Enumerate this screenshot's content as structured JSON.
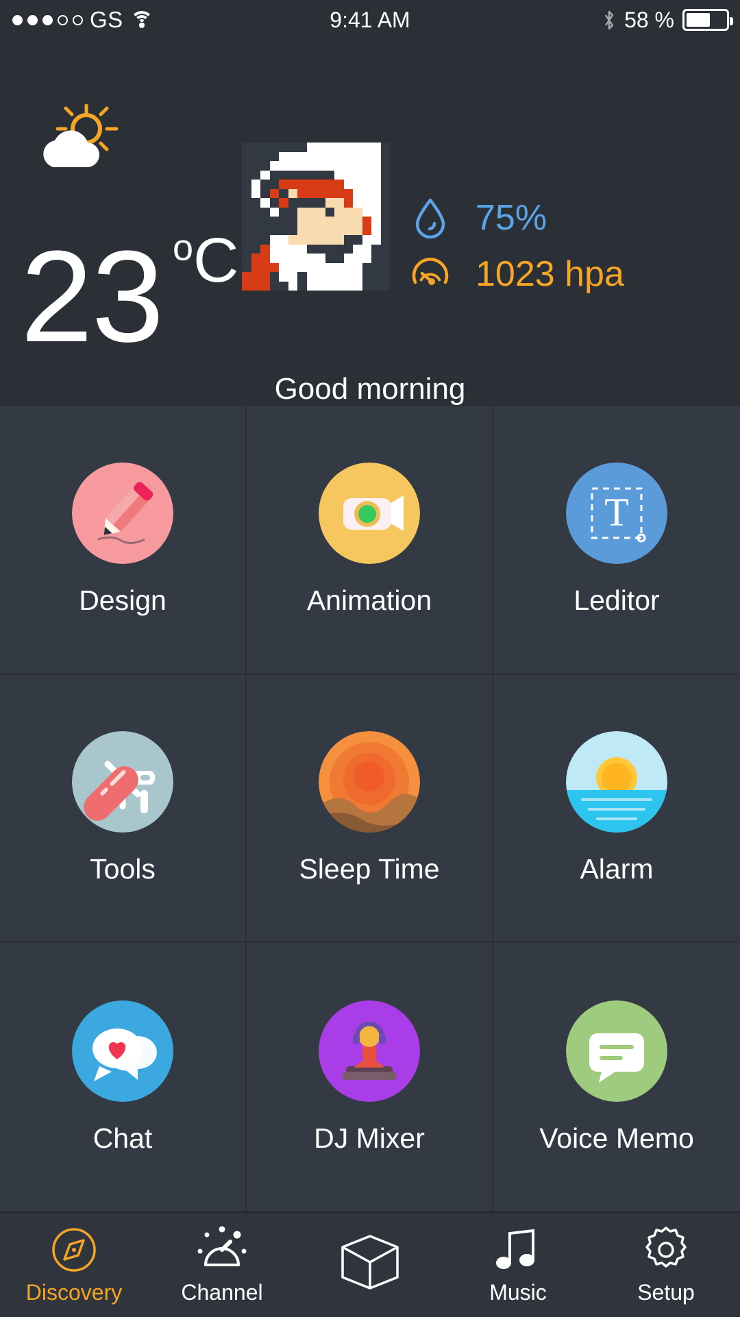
{
  "statusbar": {
    "carrier": "GS",
    "signal_dots_filled": 3,
    "signal_dots_total": 5,
    "wifi_icon": "wifi-icon",
    "time": "9:41 AM",
    "bluetooth_icon": "bluetooth-icon",
    "battery_percent": "58 %",
    "battery_level": 58
  },
  "weather": {
    "condition_icon": "sun-behind-cloud-icon",
    "temperature": "23",
    "unit": "C",
    "degree_symbol": "o",
    "greeting": "Good morning",
    "avatar_alt": "pixel-art-avatar",
    "stats": [
      {
        "name": "humidity",
        "icon": "water-drop-icon",
        "value": "75%",
        "color": "#5ba4e8"
      },
      {
        "name": "pressure",
        "icon": "gauge-icon",
        "value": "1023 hpa",
        "color": "#f5a623"
      }
    ]
  },
  "apps": [
    {
      "label": "Design",
      "icon": "pencil-icon",
      "bg": "#f79a9e"
    },
    {
      "label": "Animation",
      "icon": "video-camera-icon",
      "bg": "#f6c75f"
    },
    {
      "label": "Leditor",
      "icon": "text-tool-icon",
      "bg": "#5b9bd9"
    },
    {
      "label": "Tools",
      "icon": "pocket-knife-icon",
      "bg": "#a9c6cc"
    },
    {
      "label": "Sleep Time",
      "icon": "sunset-dune-icon",
      "bg": "#f07b35"
    },
    {
      "label": "Alarm",
      "icon": "sunrise-sea-icon",
      "bg": "#34c6f4"
    },
    {
      "label": "Chat",
      "icon": "chat-heart-icon",
      "bg": "#3ba9e0"
    },
    {
      "label": "DJ Mixer",
      "icon": "dj-turntable-icon",
      "bg": "#a93ee8"
    },
    {
      "label": "Voice Memo",
      "icon": "speech-bubble-icon",
      "bg": "#9fcb7f"
    }
  ],
  "tabbar": {
    "active_color": "#f5a623",
    "items": [
      {
        "label": "Discovery",
        "icon": "compass-icon",
        "active": true
      },
      {
        "label": "Channel",
        "icon": "dial-knob-icon",
        "active": false
      },
      {
        "label": "",
        "icon": "cube-icon",
        "active": false
      },
      {
        "label": "Music",
        "icon": "music-note-icon",
        "active": false
      },
      {
        "label": "Setup",
        "icon": "gear-icon",
        "active": false
      }
    ]
  },
  "avatar_pixels": [
    "DDDDDDDWWWWWWWWD",
    "DDDDWWWWWWWWWWWD",
    "DDDWWWWWWWWWWWWD",
    "DDWDDDDDDDWWWWWD",
    "DWDDRRRRRRRWWWWD",
    "DWDRDSRRRRRRWWWD",
    "DDWDRDDDDSSRWWWD",
    "DDDWDDSSSDSSSWWD",
    "DDDDDDSSSSSSSRWD",
    "DDDDDDSSSSSSSRWD",
    "DDDWWSSSSSSDDWWD",
    "DDRWWWWDDDDDWWDD",
    "DRRWWWWWWDDWWWDD",
    "DRRRWWWWWWWWWDDD",
    "RRRDWWDWWWWWWDDD",
    "RRRDDWDWWWWWWDDD"
  ],
  "avatar_palette": {
    "D": "#333943",
    "W": "#ffffff",
    "R": "#d83c17",
    "S": "#f8dcb0"
  }
}
